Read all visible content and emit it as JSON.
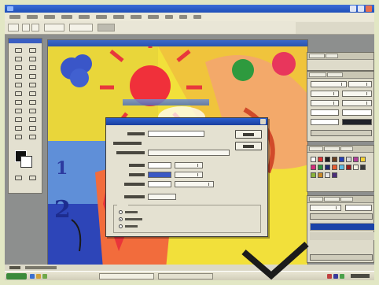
{
  "app": {
    "name": "",
    "document_title": "",
    "colors": {
      "titlebar": "#2451c0",
      "workspace": "#8d8f8e",
      "dialog_bg": "#e4e1d1",
      "accent_layer": "#1b43a8"
    }
  },
  "menubar": {
    "items": [
      "",
      "",
      "",
      "",
      "",
      "",
      "",
      "",
      "",
      "",
      "",
      ""
    ]
  },
  "dialog": {
    "title": "",
    "ok_label": "",
    "cancel_label": "",
    "fields": [
      {
        "label": "",
        "value": ""
      },
      {
        "label": "",
        "value": ""
      },
      {
        "label": "",
        "value": ""
      },
      {
        "label": "",
        "value": ""
      },
      {
        "label": "",
        "value": ""
      },
      {
        "label": "",
        "value": ""
      },
      {
        "label": "",
        "value": ""
      }
    ],
    "content_group_title": "",
    "radio_options": [
      {
        "label": "",
        "checked": false
      },
      {
        "label": "",
        "checked": true
      },
      {
        "label": "",
        "checked": false
      }
    ]
  },
  "canvas_digits": {
    "one": "1",
    "two": "2"
  },
  "icons": {
    "close": "close-icon",
    "minimize": "minimize-icon",
    "maximize": "maximize-icon",
    "tools": [
      "marquee-icon",
      "move-icon",
      "lasso-icon",
      "magic-wand-icon",
      "crop-icon",
      "slice-icon",
      "healing-icon",
      "brush-icon",
      "stamp-icon",
      "history-brush-icon",
      "eraser-icon",
      "gradient-icon",
      "blur-icon",
      "dodge-icon",
      "path-select-icon",
      "type-icon",
      "pen-icon",
      "shape-icon",
      "notes-icon",
      "eyedropper-icon",
      "hand-icon",
      "zoom-icon"
    ]
  }
}
